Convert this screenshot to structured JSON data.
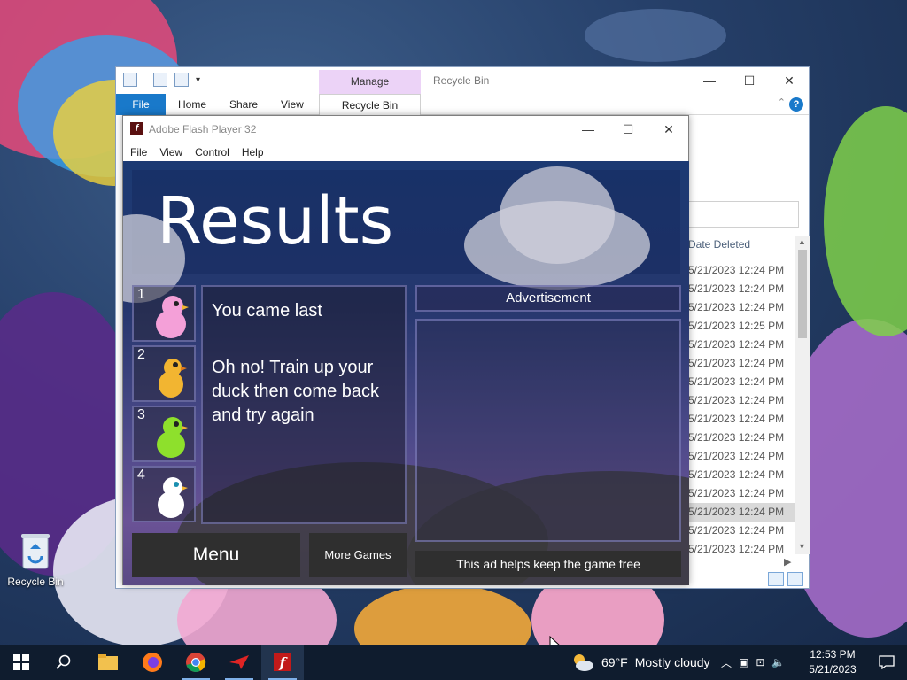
{
  "desktop": {
    "recycle_bin_label": "Recycle Bin"
  },
  "explorer": {
    "manage_label": "Manage",
    "window_title": "Recycle Bin",
    "tabs": [
      {
        "label": "File"
      },
      {
        "label": "Home"
      },
      {
        "label": "Share"
      },
      {
        "label": "View"
      },
      {
        "label": "Recycle Bin Tools"
      }
    ],
    "column_header": "Date Deleted",
    "dates": [
      "5/21/2023 12:24 PM",
      "5/21/2023 12:24 PM",
      "5/21/2023 12:24 PM",
      "5/21/2023 12:25 PM",
      "5/21/2023 12:24 PM",
      "5/21/2023 12:24 PM",
      "5/21/2023 12:24 PM",
      "5/21/2023 12:24 PM",
      "5/21/2023 12:24 PM",
      "5/21/2023 12:24 PM",
      "5/21/2023 12:24 PM",
      "5/21/2023 12:24 PM",
      "5/21/2023 12:24 PM",
      "5/21/2023 12:24 PM",
      "5/21/2023 12:24 PM",
      "5/21/2023 12:24 PM"
    ],
    "selected_row": 13
  },
  "flash": {
    "window_title": "Adobe Flash Player 32",
    "menu": [
      "File",
      "View",
      "Control",
      "Help"
    ]
  },
  "game": {
    "title": "Results",
    "ranks": [
      {
        "num": "1",
        "color": "#f4a0d8"
      },
      {
        "num": "2",
        "color": "#f2b531"
      },
      {
        "num": "3",
        "color": "#8ee02c"
      },
      {
        "num": "4",
        "color": "#ffffff"
      }
    ],
    "message_line1": "You came last",
    "message_line2": "Oh no! Train up your duck then come back and try again",
    "ad_header": "Advertisement",
    "menu_button": "Menu",
    "more_games_button": "More Games",
    "ad_footer": "This ad helps keep the game free"
  },
  "taskbar": {
    "weather_temp": "69°F",
    "weather_desc": "Mostly cloudy",
    "time": "12:53 PM",
    "date": "5/21/2023"
  },
  "colors": {
    "accent": "#1979ca",
    "taskbar": "#0f1c2e"
  }
}
